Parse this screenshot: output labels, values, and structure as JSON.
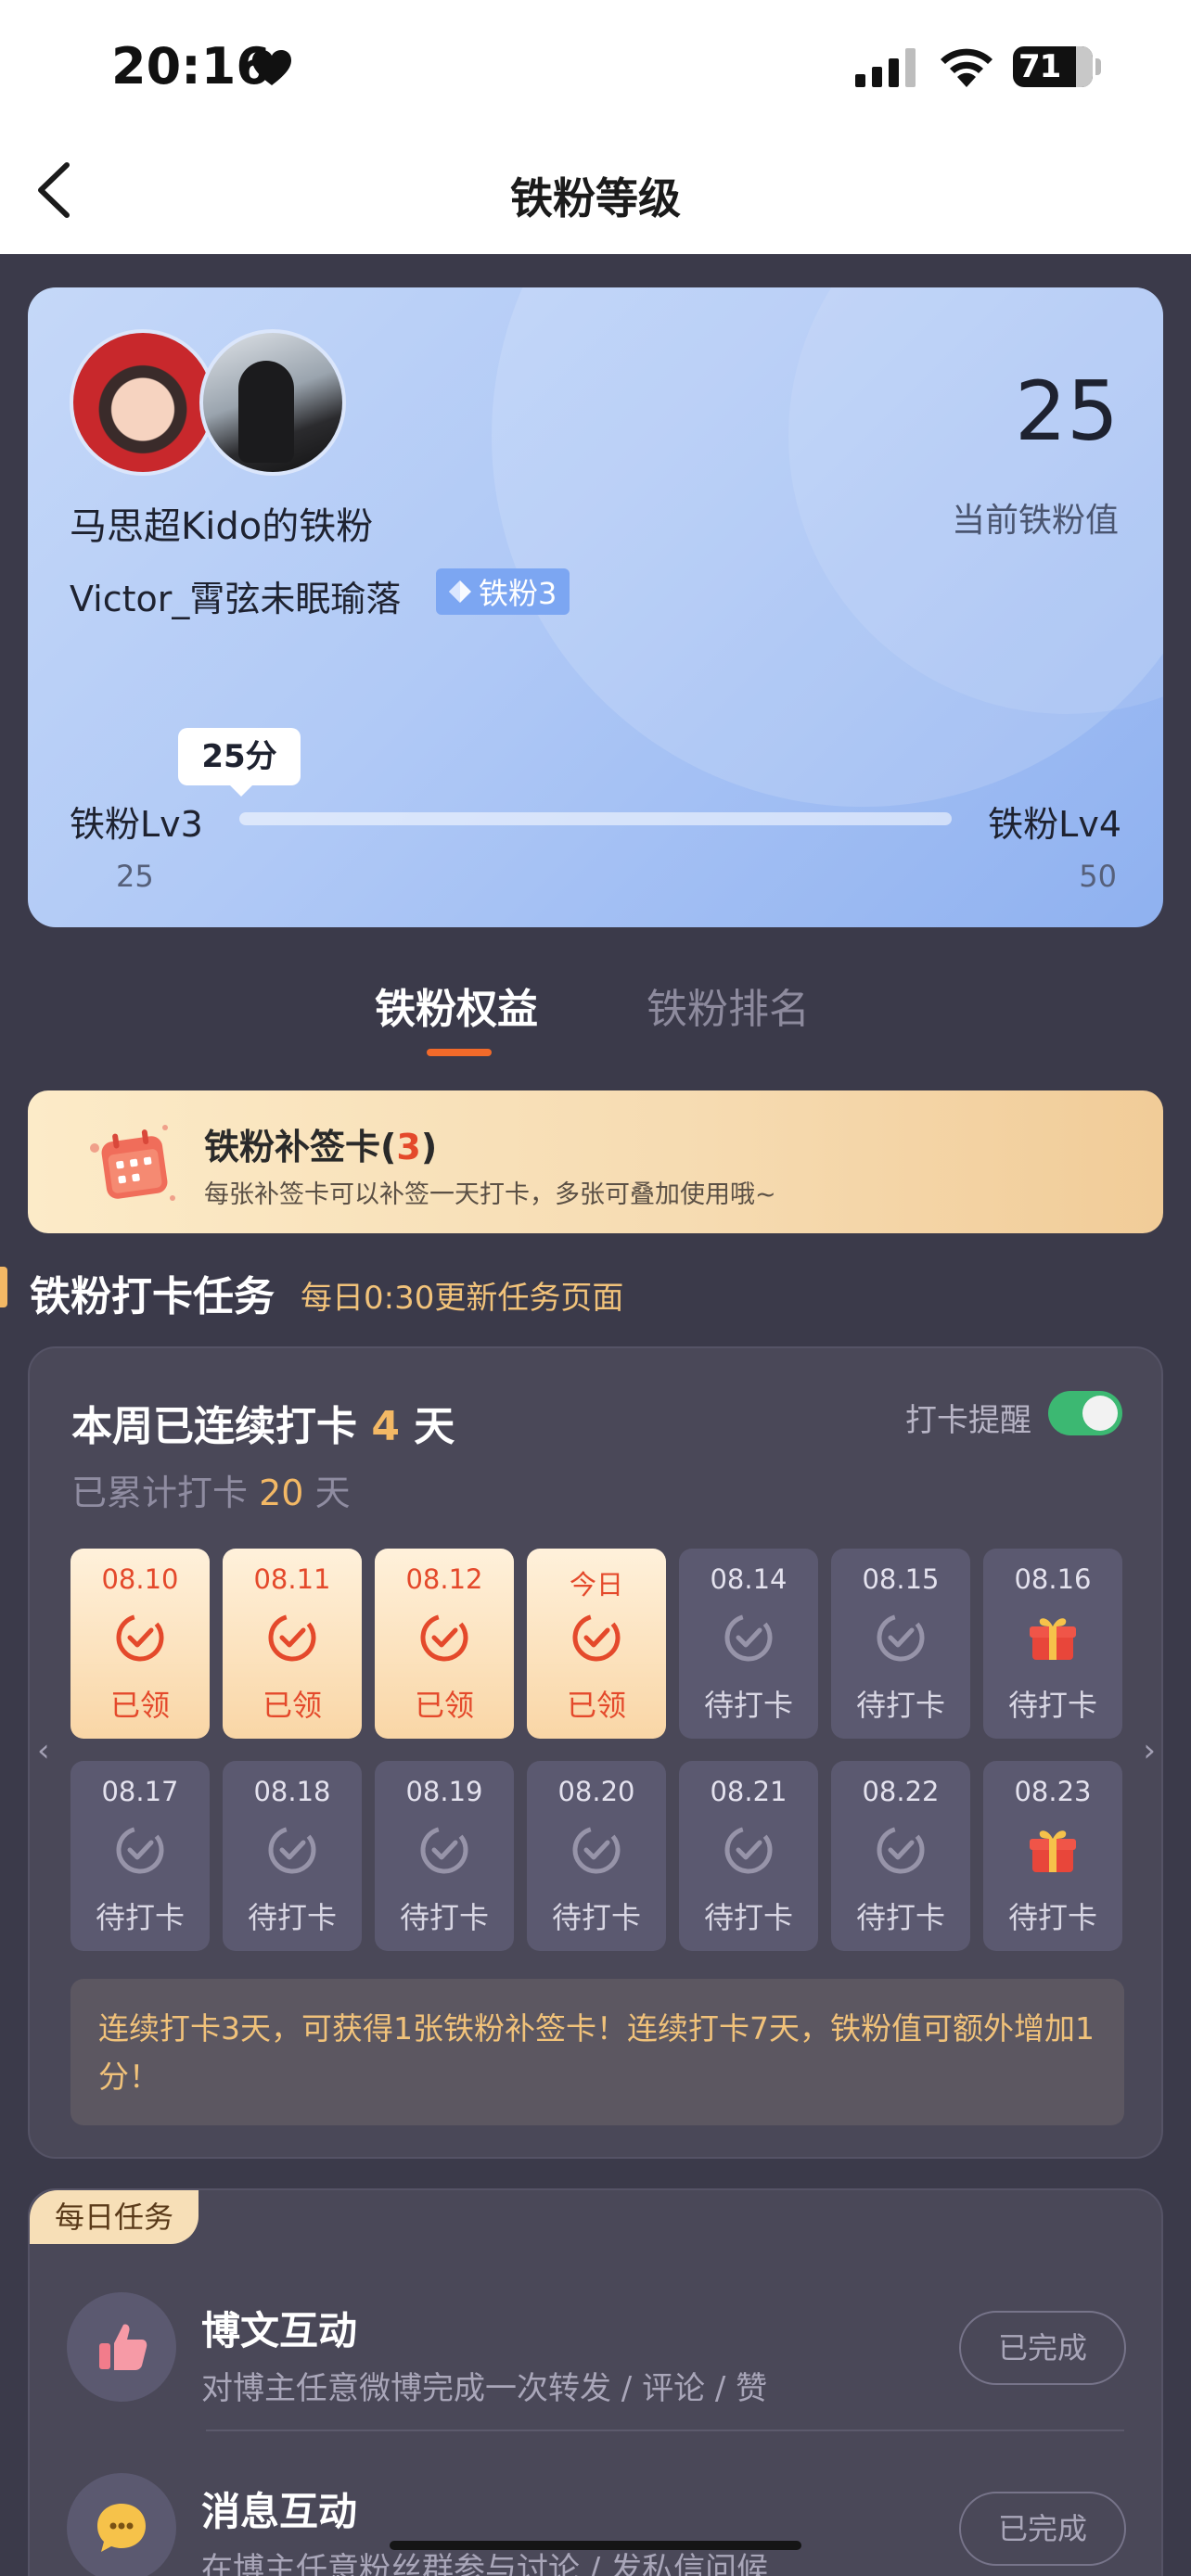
{
  "status_bar": {
    "time": "20:16",
    "battery": "71"
  },
  "nav": {
    "title": "铁粉等级"
  },
  "fan_card": {
    "name": "马思超Kido的铁粉",
    "user": "Victor_霄弦未眠瑜落",
    "badge": "铁粉3",
    "value": "25",
    "value_label": "当前铁粉值",
    "score_bubble": "25分",
    "level_current": "铁粉Lv3",
    "level_next": "铁粉Lv4",
    "level_min": "25",
    "level_max": "50",
    "progress": 0
  },
  "tabs": [
    {
      "label": "铁粉权益",
      "active": true
    },
    {
      "label": "铁粉排名",
      "active": false
    }
  ],
  "supplement_card": {
    "title": "铁粉补签卡",
    "count": "3",
    "desc": "每张补签卡可以补签一天打卡，多张可叠加使用哦~"
  },
  "checkin_section": {
    "title": "铁粉打卡任务",
    "subtitle": "每日0:30更新任务页面",
    "streak_prefix": "本周已连续打卡",
    "streak_days": "4",
    "streak_suffix": "天",
    "total_prefix": "已累计打卡",
    "total_days": "20",
    "total_suffix": "天",
    "remind_label": "打卡提醒",
    "remind_on": true,
    "days": [
      {
        "date": "08.10",
        "status": "已领",
        "state": "done"
      },
      {
        "date": "08.11",
        "status": "已领",
        "state": "done"
      },
      {
        "date": "08.12",
        "status": "已领",
        "state": "done"
      },
      {
        "date": "今日",
        "status": "已领",
        "state": "done"
      },
      {
        "date": "08.14",
        "status": "待打卡",
        "state": "pending"
      },
      {
        "date": "08.15",
        "status": "待打卡",
        "state": "pending"
      },
      {
        "date": "08.16",
        "status": "待打卡",
        "state": "gift"
      },
      {
        "date": "08.17",
        "status": "待打卡",
        "state": "pending"
      },
      {
        "date": "08.18",
        "status": "待打卡",
        "state": "pending"
      },
      {
        "date": "08.19",
        "status": "待打卡",
        "state": "pending"
      },
      {
        "date": "08.20",
        "status": "待打卡",
        "state": "pending"
      },
      {
        "date": "08.21",
        "status": "待打卡",
        "state": "pending"
      },
      {
        "date": "08.22",
        "status": "待打卡",
        "state": "pending"
      },
      {
        "date": "08.23",
        "status": "待打卡",
        "state": "gift"
      }
    ],
    "tip": "连续打卡3天，可获得1张铁粉补签卡！连续打卡7天，铁粉值可额外增加1分！"
  },
  "daily_tasks": {
    "tag": "每日任务",
    "items": [
      {
        "title": "博文互动",
        "desc": "对博主任意微博完成一次转发 / 评论 / 赞",
        "button": "已完成",
        "icon": "thumbs-up-icon"
      },
      {
        "title": "消息互动",
        "desc": "在博主任意粉丝群参与讨论 / 发私信问候",
        "button": "已完成",
        "icon": "chat-emoji-icon"
      }
    ]
  },
  "colors": {
    "background": "#3b3a4a",
    "accent": "#f26a2a",
    "highlight": "#f3b865",
    "done_text": "#e4492b",
    "toggle_on": "#3cb872"
  }
}
